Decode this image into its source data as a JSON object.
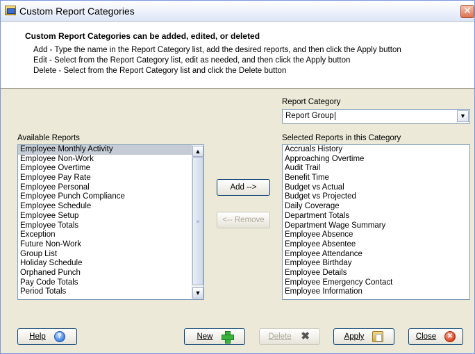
{
  "window": {
    "title": "Custom Report Categories",
    "close_glyph": "✕"
  },
  "header": {
    "title": "Custom Report Categories can be added, edited, or deleted",
    "lines": [
      "Add - Type the name in the Report Category list, add the desired reports, and then click the Apply button",
      "Edit - Select from the Report Category list, edit as needed, and then click the Apply button",
      "Delete - Select from the Report Category list and click the Delete button"
    ]
  },
  "report_category": {
    "label": "Report Category",
    "value": "Report Group"
  },
  "available_reports": {
    "label": "Available Reports",
    "selected_index": 0,
    "items": [
      "Employee Monthly Activity",
      "Employee Non-Work",
      "Employee Overtime",
      "Employee Pay Rate",
      "Employee Personal",
      "Employee Punch Compliance",
      "Employee Schedule",
      "Employee Setup",
      "Employee Totals",
      "Exception",
      "Future Non-Work",
      "Group List",
      "Holiday Schedule",
      "Orphaned Punch",
      "Pay Code Totals",
      "Period Totals"
    ]
  },
  "selected_reports": {
    "label": "Selected Reports in this Category",
    "items": [
      "Accruals History",
      "Approaching Overtime",
      "Audit Trail",
      "Benefit Time",
      "Budget vs Actual",
      "Budget vs Projected",
      "Daily Coverage",
      "Department Totals",
      "Department Wage Summary",
      "Employee Absence",
      "Employee Absentee",
      "Employee Attendance",
      "Employee Birthday",
      "Employee Details",
      "Employee Emergency Contact",
      "Employee Information"
    ]
  },
  "buttons": {
    "add": "Add -->",
    "remove": "<-- Remove",
    "help": "Help",
    "new": "New",
    "delete": "Delete",
    "apply": "Apply",
    "close": "Close"
  },
  "icons": {
    "help": "?",
    "delete": "✖",
    "close": "✕"
  }
}
